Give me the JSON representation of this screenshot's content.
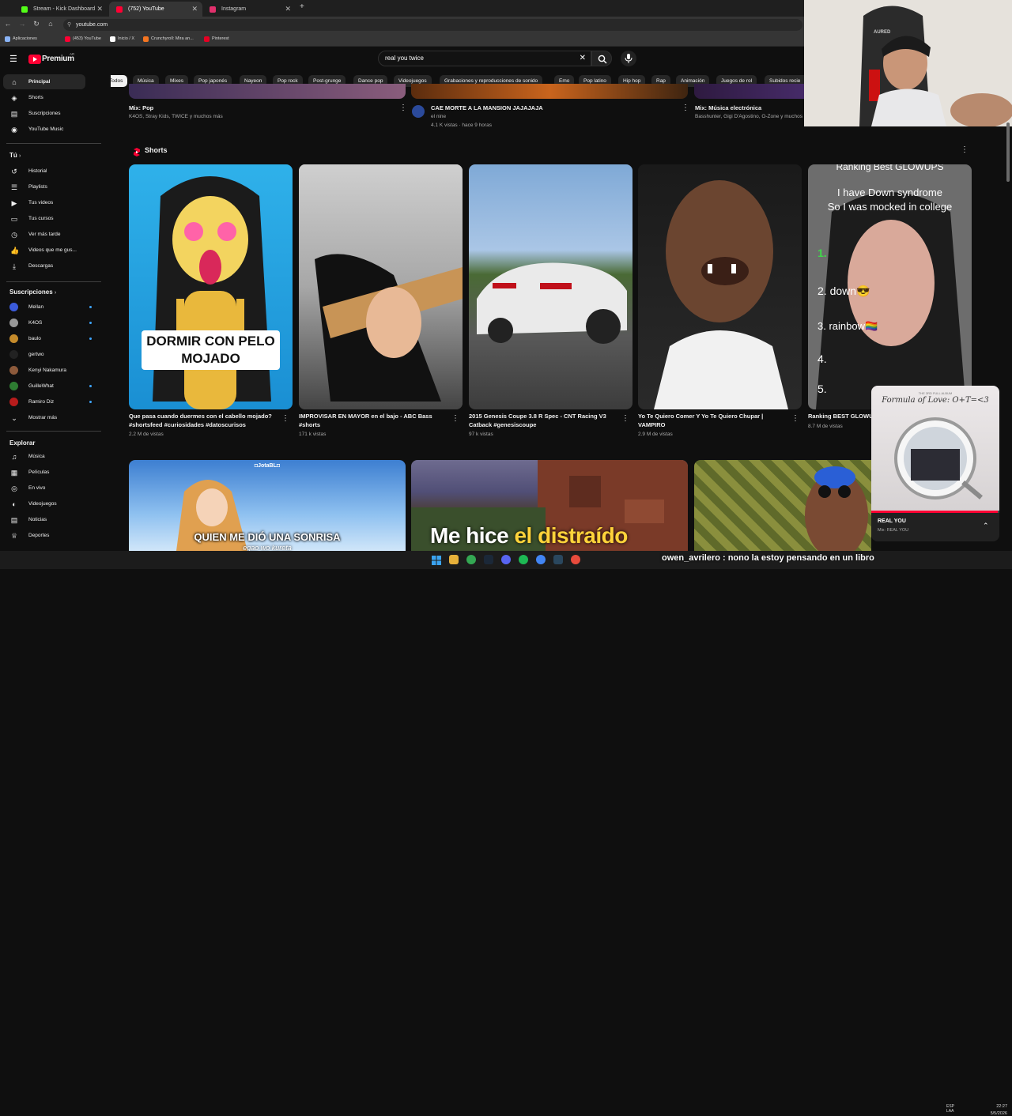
{
  "browser": {
    "tabs": [
      {
        "label": "Stream - Kick Dashboard",
        "color": "#53fc18"
      },
      {
        "label": "(752) YouTube",
        "color": "#ff0033"
      },
      {
        "label": "Instagram",
        "color": "#e1306c"
      }
    ],
    "new_tab": "+",
    "url": "youtube.com",
    "bookmarks": [
      {
        "label": "Aplicaciones",
        "color": "#8ab4f8"
      },
      {
        "label": "(453) YouTube",
        "color": "#ff0033"
      },
      {
        "label": "Inicio / X",
        "color": "#ffffff"
      },
      {
        "label": "Crunchyroll: Mira an...",
        "color": "#f47521"
      },
      {
        "label": "Pinterest",
        "color": "#e60023"
      }
    ]
  },
  "youtube": {
    "logo_text": "Premium",
    "logo_region": "AR",
    "search_value": "real you twice",
    "chips": [
      "Todos",
      "Música",
      "Mixes",
      "Pop japonés",
      "Nayeon",
      "Pop rock",
      "Post-grunge",
      "Dance pop",
      "Videojuegos",
      "Grabaciones y reproducciones de sonido",
      "Emo",
      "Pop latino",
      "Hip hop",
      "Rap",
      "Animación",
      "Juegos de rol",
      "Subidos recie"
    ],
    "sidebar": {
      "main": [
        {
          "label": "Principal",
          "icon": "⌂"
        },
        {
          "label": "Shorts",
          "icon": "◈"
        },
        {
          "label": "Suscripciones",
          "icon": "▤"
        },
        {
          "label": "YouTube Music",
          "icon": "◉"
        }
      ],
      "you_title": "Tú",
      "you": [
        {
          "label": "Historial",
          "icon": "↺"
        },
        {
          "label": "Playlists",
          "icon": "☰"
        },
        {
          "label": "Tus videos",
          "icon": "▶"
        },
        {
          "label": "Tus cursos",
          "icon": "▭"
        },
        {
          "label": "Ver más tarde",
          "icon": "◷"
        },
        {
          "label": "Videos que me gus...",
          "icon": "👍"
        },
        {
          "label": "Descargas",
          "icon": "⤓"
        }
      ],
      "subs_title": "Suscripciones",
      "subs": [
        {
          "label": "Mellan",
          "color": "#3b5bdb",
          "dot": true
        },
        {
          "label": "K4OS",
          "color": "#999",
          "dot": true
        },
        {
          "label": "baulo",
          "color": "#c58b2b",
          "dot": true
        },
        {
          "label": "gertwo",
          "color": "#222",
          "dot": false
        },
        {
          "label": "Kenyi Nakamura",
          "color": "#8d5a3b",
          "dot": false
        },
        {
          "label": "GuilleWhat",
          "color": "#2e7d32",
          "dot": true
        },
        {
          "label": "Ramiro Diz",
          "color": "#b71c1c",
          "dot": true
        }
      ],
      "show_more": "Mostrar más",
      "explore_title": "Explorar",
      "explore": [
        {
          "label": "Música",
          "icon": "♫"
        },
        {
          "label": "Películas",
          "icon": "▦"
        },
        {
          "label": "En vivo",
          "icon": "◎"
        },
        {
          "label": "Videojuegos",
          "icon": "◐"
        },
        {
          "label": "Noticias",
          "icon": "▤"
        },
        {
          "label": "Deportes",
          "icon": "♕"
        }
      ]
    },
    "top_videos": [
      {
        "title": "Mix: Pop",
        "meta1": "K4OS, Stray Kids, TWICE y muchos más",
        "meta2": ""
      },
      {
        "title": "CAE MORTE A LA MANSION JAJAJAJA",
        "meta1": "el nine",
        "meta2": "4.1 K vistas · hace 9 horas"
      },
      {
        "title": "Mix: Música electrónica",
        "meta1": "Basshunter, Gigi D'Agostino, O-Zone y muchos más",
        "meta2": ""
      }
    ],
    "shorts_title": "Shorts",
    "shorts": [
      {
        "title": "Que pasa cuando duermes con el cabello mojado? #shortsfeed #curiosidades #datoscurisos",
        "views": "2.2 M de vistas",
        "overlay": "DORMIR CON PELO MOJADO"
      },
      {
        "title": "IMPROVISAR EN MAYOR en el bajo - ABC Bass #shorts",
        "views": "171 k vistas",
        "overlay": ""
      },
      {
        "title": "2015 Genesis Coupe 3.8 R Spec - CNT Racing V3 Catback #genesiscoupe",
        "views": "97 k vistas",
        "overlay": ""
      },
      {
        "title": "Yo Te Quiero Comer Y Yo Te Quiero Chupar | VAMPIRO",
        "views": "2.9 M de vistas",
        "overlay": ""
      },
      {
        "title": "Ranking BEST GLOWU",
        "views": "8.7 M de vistas",
        "overlay": "Ranking Best GLOWUPS"
      }
    ],
    "short5_lines": [
      "I have Down syndrome",
      "So I was mocked in college",
      "1.",
      "2. down😎",
      "3. rainbow🏳️‍🌈",
      "4.",
      "5."
    ],
    "bottom_videos": [
      {
        "overlay": "QUIEN ME DIÓ UNA SONRISA",
        "sub": "egao wo kureta",
        "tag": "◘JotaBL◘"
      },
      {
        "overlay_a": "Me hice ",
        "overlay_b": "el distraído"
      },
      {
        "overlay": ""
      }
    ],
    "miniplayer": {
      "title": "REAL YOU",
      "sub": "Mix: REAL YOU",
      "album": "Formula of Love: O+T=<3",
      "album_top": "THE 3RD FULL ALBUM"
    }
  },
  "stream_chat": {
    "user": "owen_avrilero",
    "message": ": nono la estoy pensando en un libro"
  },
  "taskbar": {
    "lang": "ESP\nLAA",
    "time": "22:27",
    "date": "5/5/2026"
  }
}
